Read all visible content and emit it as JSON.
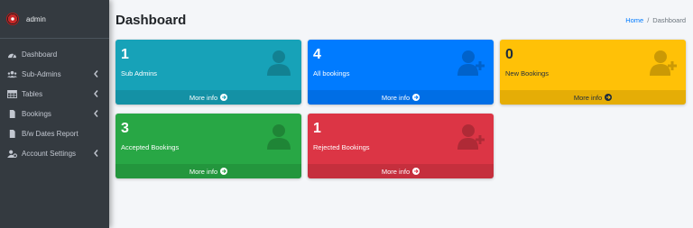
{
  "brand": {
    "name": "admin",
    "icon": "logo-icon"
  },
  "sidebar": {
    "items": [
      {
        "label": "Dashboard",
        "icon": "dashboard-icon",
        "has_submenu": false
      },
      {
        "label": "Sub-Admins",
        "icon": "users-icon",
        "has_submenu": true
      },
      {
        "label": "Tables",
        "icon": "table-icon",
        "has_submenu": true
      },
      {
        "label": "Bookings",
        "icon": "file-icon",
        "has_submenu": true
      },
      {
        "label": "B/w Dates Report",
        "icon": "file-icon",
        "has_submenu": false
      },
      {
        "label": "Account Settings",
        "icon": "user-cog-icon",
        "has_submenu": true
      }
    ]
  },
  "header": {
    "title": "Dashboard",
    "breadcrumb": {
      "home": "Home",
      "separator": "/",
      "current": "Dashboard"
    }
  },
  "cards": [
    {
      "count": "1",
      "label": "Sub Admins",
      "footer": "More info",
      "color": "#17a2b8",
      "icon": "user-icon"
    },
    {
      "count": "4",
      "label": "All bookings",
      "footer": "More info",
      "color": "#007bff",
      "icon": "user-plus-icon"
    },
    {
      "count": "0",
      "label": "New Bookings",
      "footer": "More info",
      "color": "#ffc107",
      "icon": "user-plus-icon"
    },
    {
      "count": "3",
      "label": "Accepted Bookings",
      "footer": "More info",
      "color": "#28a745",
      "icon": "user-icon"
    },
    {
      "count": "1",
      "label": "Rejected Bookings",
      "footer": "More info",
      "color": "#dc3545",
      "icon": "user-plus-icon"
    }
  ]
}
